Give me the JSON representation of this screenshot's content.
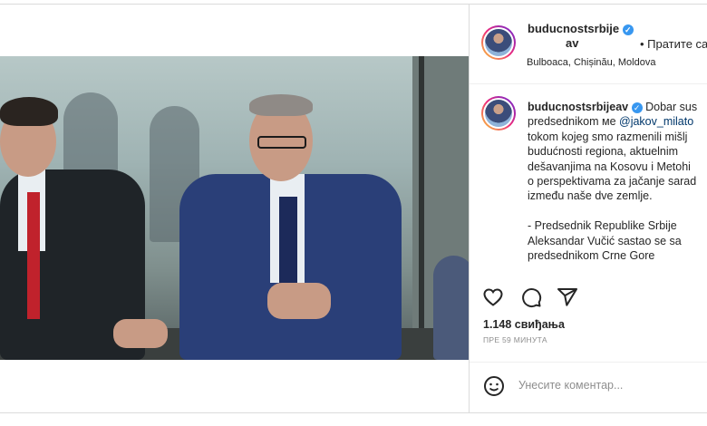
{
  "post": {
    "username": "buducnostsrbije",
    "username_line2": "av",
    "follow_label": "• Пратите са",
    "location": "Bulboaca, Chișinău, Moldova",
    "caption": {
      "username": "buducnostsrbijeav",
      "text_part1": " Dobar sus",
      "text_line2": "predsednikom ме ",
      "mention": "@jakov_milato",
      "text_rest": "tokom kojeg smo razmenili mišlj\nbudućnosti regiona, aktuelnim\ndešavanjima na Kosovu i Metohi\no perspektivama za jačanje sarad\nizmeđu naše dve zemlje.\n\n- Predsednik Republike Srbije\nAleksandar Vučić sastao se sa\npredsednikom Crne Gore"
    },
    "likes": "1.148 свиђања",
    "time": "ПРЕ 59 МИНУТА",
    "comment_placeholder": "Унесите коментар..."
  },
  "icons": {
    "like": "heart-icon",
    "comment": "comment-icon",
    "share": "share-icon",
    "verified": "verified-badge-icon",
    "emoji": "emoji-icon"
  },
  "colors": {
    "verified": "#3897f0",
    "mention": "#00376b",
    "muted": "#8e8e8e",
    "text": "#262626"
  }
}
